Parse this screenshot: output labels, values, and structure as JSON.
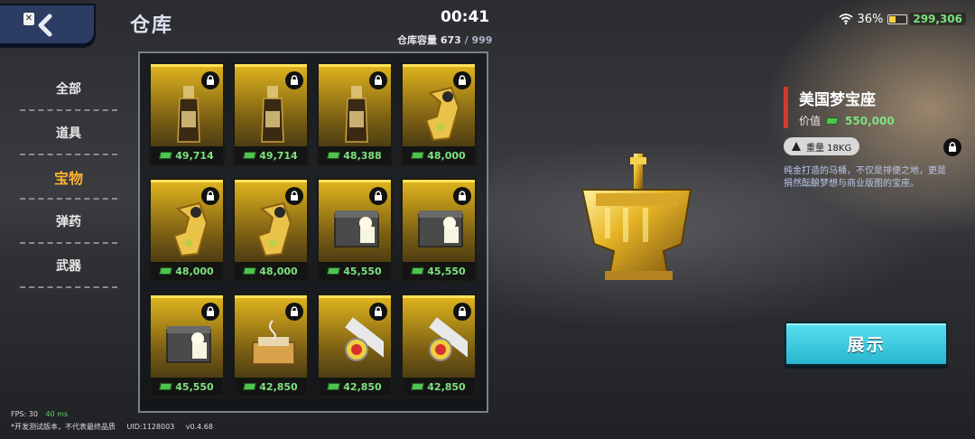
{
  "header": {
    "title": "仓库",
    "clock": "00:41",
    "capacity_label": "仓库容量",
    "capacity_used": "673",
    "capacity_max": "/ 999",
    "battery": "36%",
    "money": "299,306"
  },
  "sidebar": {
    "items": [
      {
        "label": "全部",
        "active": false
      },
      {
        "label": "道具",
        "active": false
      },
      {
        "label": "宝物",
        "active": true
      },
      {
        "label": "弹药",
        "active": false
      },
      {
        "label": "武器",
        "active": false
      }
    ]
  },
  "inventory": {
    "slots": [
      {
        "item": "bottle-icon",
        "price": "49,714"
      },
      {
        "item": "bottle-icon",
        "price": "49,714"
      },
      {
        "item": "bottle-icon",
        "price": "48,388"
      },
      {
        "item": "ring-icon",
        "price": "48,000"
      },
      {
        "item": "ring-icon",
        "price": "48,000"
      },
      {
        "item": "ring-icon",
        "price": "48,000"
      },
      {
        "item": "device-icon",
        "price": "45,550"
      },
      {
        "item": "device-icon",
        "price": "45,550"
      },
      {
        "item": "device-icon",
        "price": "45,550"
      },
      {
        "item": "typewriter-icon",
        "price": "42,850"
      },
      {
        "item": "watch-icon",
        "price": "42,850"
      },
      {
        "item": "watch-icon",
        "price": "42,850"
      }
    ]
  },
  "detail": {
    "name": "美国梦宝座",
    "value_label": "价值",
    "value": "550,000",
    "weight": "重量 18KG",
    "description": "纯金打造的马桶，不仅是排便之地，更是捐然酝酿梦想与商业版图的宝座。",
    "show_button": "展示"
  },
  "footer": {
    "fps": "FPS: 30",
    "ping": "40 ms",
    "note": "*开发测试版本，不代表最终品质",
    "uid": "UID:1128003",
    "version": "v0.4.68"
  },
  "colors": {
    "accent_gold": "#e2b61e",
    "price_green": "#7de27e",
    "active_tab": "#ffb12e",
    "button_cyan": "#28b7d0"
  }
}
